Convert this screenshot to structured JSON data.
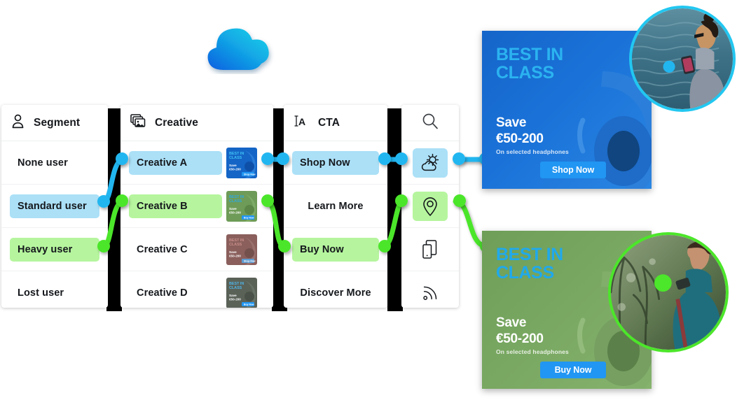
{
  "logo": {
    "icon": "cloud-icon",
    "gradient_from": "#0B5FE0",
    "gradient_to": "#15D6E8"
  },
  "columns": {
    "segment": {
      "header": {
        "icon": "user-icon",
        "title": "Segment"
      },
      "rows": [
        {
          "label": "None user",
          "highlight": "none"
        },
        {
          "label": "Standard user",
          "highlight": "blue"
        },
        {
          "label": "Heavy user",
          "highlight": "green"
        },
        {
          "label": "Lost user",
          "highlight": "none"
        }
      ]
    },
    "creative": {
      "header": {
        "icon": "images-icon",
        "title": "Creative"
      },
      "rows": [
        {
          "label": "Creative A",
          "highlight": "blue",
          "thumb": "ad-thumb-blue"
        },
        {
          "label": "Creative B",
          "highlight": "green",
          "thumb": "ad-thumb-green"
        },
        {
          "label": "Creative C",
          "highlight": "none",
          "thumb": "ad-thumb-red"
        },
        {
          "label": "Creative D",
          "highlight": "none",
          "thumb": "ad-thumb-dark"
        }
      ]
    },
    "cta": {
      "header": {
        "icon": "text-cursor-icon",
        "title": "CTA"
      },
      "rows": [
        {
          "label": "Shop Now",
          "highlight": "blue"
        },
        {
          "label": "Learn More",
          "highlight": "none"
        },
        {
          "label": "Buy Now",
          "highlight": "green"
        },
        {
          "label": "Discover More",
          "highlight": "none"
        }
      ]
    },
    "context": {
      "header": {
        "icon": "search-icon"
      },
      "rows": [
        {
          "icon": "weather-icon",
          "highlight": "blue"
        },
        {
          "icon": "location-pin-icon",
          "highlight": "green"
        },
        {
          "icon": "devices-icon",
          "highlight": "none"
        },
        {
          "icon": "signal-icon",
          "highlight": "none"
        }
      ]
    }
  },
  "ads": [
    {
      "variant": "blue",
      "headline_line1": "BEST IN",
      "headline_line2": "CLASS",
      "save_line1": "Save",
      "save_line2": "€50-200",
      "subtext": "On selected headphones",
      "cta": "Shop Now",
      "photo": "person-by-the-sea-photo"
    },
    {
      "variant": "green",
      "headline_line1": "BEST IN",
      "headline_line2": "CLASS",
      "save_line1": "Save",
      "save_line2": "€50-200",
      "subtext": "On selected headphones",
      "cta": "Buy Now",
      "photo": "person-in-forest-photo"
    }
  ],
  "colors": {
    "highlight_blue": "#ABE0F7",
    "highlight_green": "#B6F59E",
    "wire_blue": "#22B6F0",
    "wire_green": "#4CE62A",
    "bar_black": "#000000",
    "ad_cta_blue": "#2196F3"
  }
}
